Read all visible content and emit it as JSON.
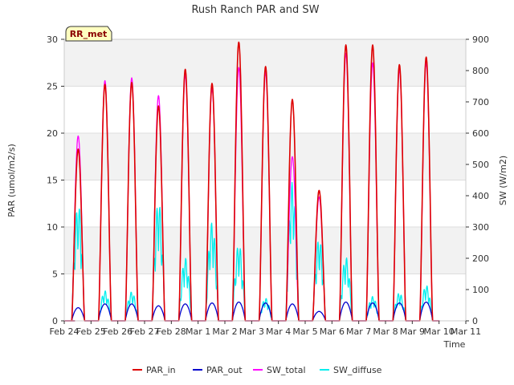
{
  "chart_data": {
    "type": "line",
    "title": "Rush Ranch PAR and SW",
    "xlabel": "Time",
    "ylabel_left": "PAR (umol/m2/s)",
    "ylabel_right": "SW (W/m2)",
    "badge": "RR_met",
    "x_ticks": [
      "Feb 24",
      "Feb 25",
      "Feb 26",
      "Feb 27",
      "Feb 28",
      "Mar 1",
      "Mar 2",
      "Mar 3",
      "Mar 4",
      "Mar 5",
      "Mar 6",
      "Mar 7",
      "Mar 8",
      "Mar 9",
      "Mar 10",
      "Mar 11"
    ],
    "xlim": [
      0,
      15
    ],
    "ylim_left": [
      0,
      30
    ],
    "ylim_right": [
      0,
      900
    ],
    "y_ticks_left": [
      0,
      5,
      10,
      15,
      20,
      25,
      30
    ],
    "y_ticks_right": [
      0,
      100,
      200,
      300,
      400,
      500,
      600,
      700,
      800,
      900
    ],
    "grid": true,
    "legend_position": "bottom",
    "day_peaks": [
      {
        "day": "Feb 24",
        "PAR_in": 18.3,
        "PAR_out": 1.4,
        "SW_total": 19.7,
        "SW_diffuse": 12.5
      },
      {
        "day": "Feb 25",
        "PAR_in": 25.2,
        "PAR_out": 1.8,
        "SW_total": 25.6,
        "SW_diffuse": 3.2
      },
      {
        "day": "Feb 26",
        "PAR_in": 25.4,
        "PAR_out": 1.8,
        "SW_total": 25.9,
        "SW_diffuse": 3.1
      },
      {
        "day": "Feb 27",
        "PAR_in": 22.9,
        "PAR_out": 1.6,
        "SW_total": 24.0,
        "SW_diffuse": 12.8
      },
      {
        "day": "Feb 28",
        "PAR_in": 26.8,
        "PAR_out": 1.8,
        "SW_total": 26.2,
        "SW_diffuse": 6.7
      },
      {
        "day": "Mar 1",
        "PAR_in": 25.3,
        "PAR_out": 1.9,
        "SW_total": 24.8,
        "SW_diffuse": 10.5
      },
      {
        "day": "Mar 2",
        "PAR_in": 29.7,
        "PAR_out": 2.0,
        "SW_total": 27.0,
        "SW_diffuse": 8.2
      },
      {
        "day": "Mar 3",
        "PAR_in": 27.1,
        "PAR_out": 1.9,
        "SW_total": 26.5,
        "SW_diffuse": 2.4
      },
      {
        "day": "Mar 4",
        "PAR_in": 23.6,
        "PAR_out": 1.8,
        "SW_total": 17.5,
        "SW_diffuse": 14.8
      },
      {
        "day": "Mar 5",
        "PAR_in": 13.9,
        "PAR_out": 1.0,
        "SW_total": 13.2,
        "SW_diffuse": 8.8
      },
      {
        "day": "Mar 6",
        "PAR_in": 29.4,
        "PAR_out": 2.0,
        "SW_total": 28.5,
        "SW_diffuse": 6.8
      },
      {
        "day": "Mar 7",
        "PAR_in": 29.4,
        "PAR_out": 1.9,
        "SW_total": 27.5,
        "SW_diffuse": 2.6
      },
      {
        "day": "Mar 8",
        "PAR_in": 27.3,
        "PAR_out": 1.9,
        "SW_total": 26.8,
        "SW_diffuse": 3.0
      },
      {
        "day": "Mar 9",
        "PAR_in": 28.1,
        "PAR_out": 2.0,
        "SW_total": 27.5,
        "SW_diffuse": 3.8
      }
    ],
    "series": [
      {
        "name": "PAR_in",
        "color": "#dd0000",
        "axis": "left"
      },
      {
        "name": "PAR_out",
        "color": "#0000cc",
        "axis": "left"
      },
      {
        "name": "SW_total",
        "color": "#ff00ff",
        "axis": "left"
      },
      {
        "name": "SW_diffuse",
        "color": "#00eeee",
        "axis": "left"
      }
    ]
  }
}
